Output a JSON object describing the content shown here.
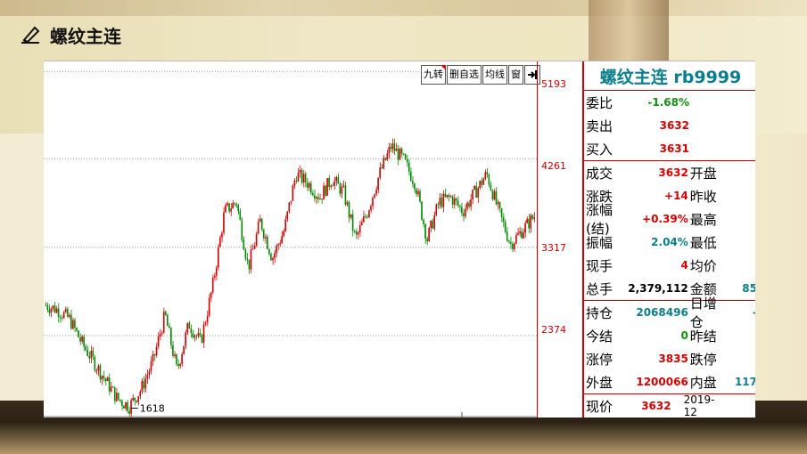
{
  "slide": {
    "title": "螺纹主连"
  },
  "toolbar": [
    "九转",
    "删自选",
    "均线",
    "窗"
  ],
  "chart_data": {
    "type": "candlestick",
    "y_ticks": [
      "5193",
      "4261",
      "3317",
      "2374"
    ],
    "low_marker": "1618",
    "ylim": [
      1500,
      5300
    ],
    "series_line_color": "#cc0000",
    "close_approx": [
      2700,
      2650,
      2550,
      2300,
      2100,
      1900,
      1700,
      1618,
      1800,
      2100,
      2600,
      2000,
      2500,
      2300,
      2900,
      3700,
      3800,
      3100,
      3600,
      3200,
      3500,
      4100,
      4000,
      3850,
      4050,
      3900,
      3400,
      3700,
      4100,
      4400,
      4250,
      4000,
      3400,
      3800,
      3850,
      3700,
      3900,
      4100,
      3700,
      3350,
      3500,
      3650
    ]
  },
  "quote": {
    "header": "螺纹主连 rb9999",
    "rows1": [
      {
        "label": "委比",
        "value": "-1.68%",
        "color": "green"
      },
      {
        "label": "卖出",
        "value": "3632",
        "color": "red"
      },
      {
        "label": "买入",
        "value": "3631",
        "color": "red"
      }
    ],
    "rows2": [
      {
        "label": "成交",
        "value": "3632",
        "color": "red",
        "label2": "开盘",
        "value2": ""
      },
      {
        "label": "涨跌",
        "value": "+14",
        "color": "red",
        "label2": "昨收",
        "value2": ""
      },
      {
        "label": "涨幅(结)",
        "value": "+0.39%",
        "color": "red",
        "label2": "最高",
        "value2": ""
      },
      {
        "label": "振幅",
        "value": "2.04%",
        "color": "teal",
        "label2": "最低",
        "value2": ""
      },
      {
        "label": "现手",
        "value": "4",
        "color": "red",
        "label2": "均价",
        "value2": ""
      },
      {
        "label": "总手",
        "value": "2,379,112",
        "color": "black",
        "label2": "金额",
        "value2": "85"
      }
    ],
    "rows3": [
      {
        "label": "持仓",
        "value": "2068496",
        "color": "teal",
        "label2": "日增仓",
        "value2": "-"
      },
      {
        "label": "今结",
        "value": "0",
        "color": "green",
        "label2": "昨结",
        "value2": ""
      },
      {
        "label": "涨停",
        "value": "3835",
        "color": "red",
        "label2": "跌停",
        "value2": ""
      },
      {
        "label": "外盘",
        "value": "1200066",
        "color": "red",
        "label2": "内盘",
        "value2": "117"
      }
    ],
    "rows4": [
      {
        "label": "现价",
        "value": "3632",
        "color": "red",
        "label2": "2019-12",
        "value2": ""
      }
    ]
  }
}
